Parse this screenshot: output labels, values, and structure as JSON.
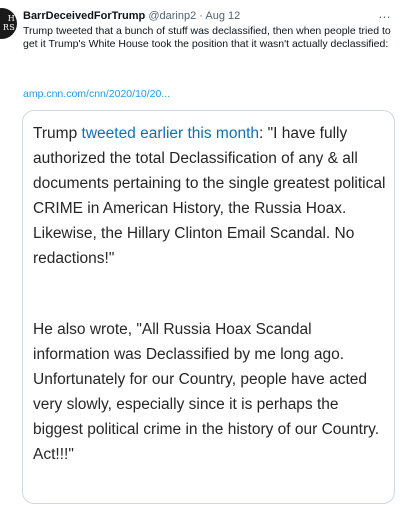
{
  "tweet": {
    "avatar_text": [
      "H",
      "RS"
    ],
    "author_name": "BarrDeceivedForTrump",
    "handle": "@darinp2",
    "separator": "·",
    "date": "Aug 12",
    "more_icon": "…",
    "text": "Trump tweeted that a bunch of stuff was declassified, then when people tried to get it Trump's White House took the position that it wasn't actually declassified:",
    "link_text": "amp.cnn.com/cnn/2020/10/20..."
  },
  "quote": {
    "para1_prefix": "Trump ",
    "para1_link": "tweeted earlier this month",
    "para1_suffix": ": \"I have fully authorized the total Declassification of any & all documents pertaining to the single greatest political CRIME in American History, the Russia Hoax. Likewise, the Hillary Clinton Email Scandal. No redactions!\"",
    "para2": "He also wrote, \"All Russia Hoax Scandal information was Declassified by me long ago. Unfortunately for our Country, people have acted very slowly, especially since it is perhaps the biggest political crime in the history of our Country. Act!!!\""
  },
  "colors": {
    "link": "#1d9bf0",
    "quote_link": "#0c72b6",
    "muted": "#536471",
    "border": "#cfd9de"
  }
}
